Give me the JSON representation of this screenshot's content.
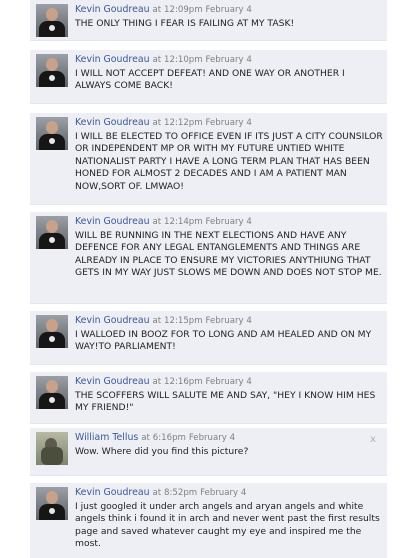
{
  "comments": [
    {
      "author": "Kevin Goudreau",
      "at": "at",
      "time": "12:09pm",
      "date": "February 4",
      "text": "THE ONLY THING I FEAR IS FAILING AT MY TASK!"
    },
    {
      "author": "Kevin Goudreau",
      "at": "at",
      "time": "12:10pm",
      "date": "February 4",
      "text": "I WILL NOT ACCEPT DEFEAT! AND ONE WAY OR ANOTHER I ALWAYS COME BACK!"
    },
    {
      "author": "Kevin Goudreau",
      "at": "at",
      "time": "12:12pm",
      "date": "February 4",
      "text": "I WILL BE ELECTED TO OFFICE EVEN IF ITS JUST A CITY COUNSILOR OR INDEPENDENT MP OR WITH MY FUTURE UNTIED WHITE NATIONALIST PARTY I HAVE A LONG TERM PLAN THAT HAS BEEN HONED FOR ALMOST 2 DECADES AND I AM A PATIENT MAN NOW,SORT OF. LMWAO!"
    },
    {
      "author": "Kevin Goudreau",
      "at": "at",
      "time": "12:14pm",
      "date": "February 4",
      "text": "WILL BE RUNNING IN THE NEXT ELECTIONS AND HAVE ANY DEFENCE FOR ANY LEGAL ENTANGLEMENTS AND THINGS ARE ALREADY IN PLACE TO ENSURE MY VICTORIES ANYTHIUNG THAT GETS IN MY WAY JUST SLOWS ME DOWN AND DOES NOT STOP ME."
    },
    {
      "author": "Kevin Goudreau",
      "at": "at",
      "time": "12:15pm",
      "date": "February 4",
      "text": "I WALLOED IN BOOZ FOR TO LONG AND AM HEALED AND ON MY WAY!TO PARLIAMENT!"
    },
    {
      "author": "Kevin Goudreau",
      "at": "at",
      "time": "12:16pm",
      "date": "February 4",
      "text": "THE SCOFFERS WILL SALUTE ME AND SAY, \"HEY I KNOW HIM HES MY FRIEND!\""
    },
    {
      "author": "William Tellus",
      "at": "at",
      "time": "6:16pm",
      "date": "February 4",
      "text": "Wow. Where did you find this picture?",
      "close": "x"
    },
    {
      "author": "Kevin Goudreau",
      "at": "at",
      "time": "8:52pm",
      "date": "February 4",
      "text": "I just googled it under arch angels and aryan angels and white angels think i found it in arch and never went past the first results page and saved whatever caught my eye and inspired me the most."
    }
  ]
}
